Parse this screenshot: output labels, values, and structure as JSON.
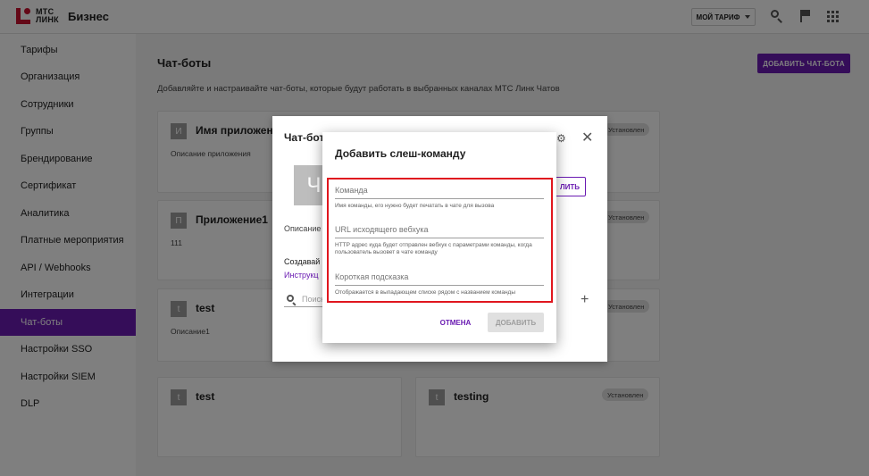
{
  "header": {
    "logo_line1": "МТС",
    "logo_line2": "ЛИНК",
    "brand": "Бизнес",
    "tariff_label": "МОЙ ТАРИФ"
  },
  "sidebar": {
    "items": [
      {
        "label": "Тарифы"
      },
      {
        "label": "Организация"
      },
      {
        "label": "Сотрудники"
      },
      {
        "label": "Группы"
      },
      {
        "label": "Брендирование"
      },
      {
        "label": "Сертификат"
      },
      {
        "label": "Аналитика"
      },
      {
        "label": "Платные мероприятия"
      },
      {
        "label": "API / Webhooks"
      },
      {
        "label": "Интеграции"
      },
      {
        "label": "Чат-боты"
      },
      {
        "label": "Настройки SSO"
      },
      {
        "label": "Настройки SIEM"
      },
      {
        "label": "DLP"
      }
    ],
    "active": "Чат-боты"
  },
  "main": {
    "title": "Чат-боты",
    "description": "Добавляйте и настраивайте чат-боты, которые будут работать в выбранных каналах МТС Линк Чатов",
    "add_button": "ДОБАВИТЬ ЧАТ-БОТА",
    "cards": [
      {
        "initial": "И",
        "title": "Имя приложения",
        "description": "Описание приложения",
        "badge": "Установлен"
      },
      {
        "initial": "П",
        "title": "Приложение1",
        "description": "111",
        "badge": "Установлен"
      },
      {
        "initial": "t",
        "title": "test",
        "description": "Описание1",
        "badge": ""
      },
      {
        "initial": "t",
        "title": "test",
        "description": "",
        "badge": ""
      },
      {
        "initial": "t",
        "title": "testing",
        "description": "",
        "badge": "Установлен"
      }
    ],
    "extra_badge": "Установлен"
  },
  "bot_dialog": {
    "title": "Чат-бот",
    "avatar_initial": "Ч",
    "save_button_partial": "ЛИТЬ",
    "description_label": "Описание",
    "create_label": "Создавай",
    "instruction_link": "Инструкц",
    "search_placeholder": "Поиск"
  },
  "slash_dialog": {
    "title": "Добавить слеш-команду",
    "fields": [
      {
        "placeholder": "Команда",
        "hint": "Имя команды, его нужно будет печатать в чате для вызова"
      },
      {
        "placeholder": "URL исходящего вебхука",
        "hint": "HTTP адрес куда будет отправлен вебхук с параметрами команды, когда пользователь вызовет в чате команду"
      },
      {
        "placeholder": "Короткая подсказка",
        "hint": "Отображается в выпадающем списке рядом с названием команды"
      }
    ],
    "cancel_button": "ОТМЕНА",
    "add_button": "ДОБАВИТЬ"
  },
  "colors": {
    "accent": "#6a1bb2",
    "brand_red": "#c8102e",
    "highlight": "#e0161e"
  }
}
